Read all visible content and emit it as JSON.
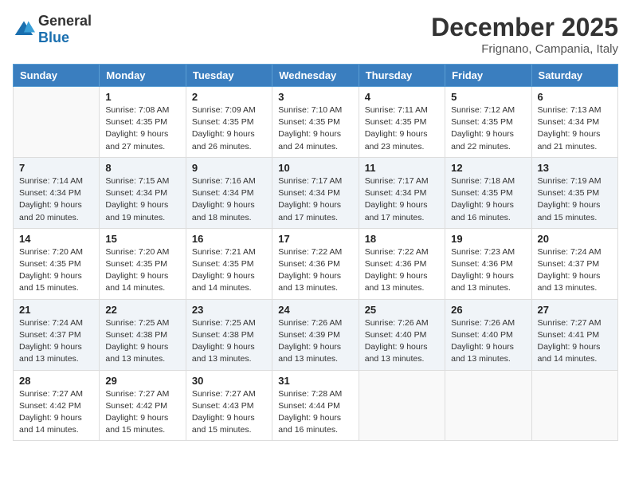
{
  "header": {
    "logo_general": "General",
    "logo_blue": "Blue",
    "month_title": "December 2025",
    "location": "Frignano, Campania, Italy"
  },
  "weekdays": [
    "Sunday",
    "Monday",
    "Tuesday",
    "Wednesday",
    "Thursday",
    "Friday",
    "Saturday"
  ],
  "weeks": [
    [
      {
        "day": "",
        "info": ""
      },
      {
        "day": "1",
        "info": "Sunrise: 7:08 AM\nSunset: 4:35 PM\nDaylight: 9 hours\nand 27 minutes."
      },
      {
        "day": "2",
        "info": "Sunrise: 7:09 AM\nSunset: 4:35 PM\nDaylight: 9 hours\nand 26 minutes."
      },
      {
        "day": "3",
        "info": "Sunrise: 7:10 AM\nSunset: 4:35 PM\nDaylight: 9 hours\nand 24 minutes."
      },
      {
        "day": "4",
        "info": "Sunrise: 7:11 AM\nSunset: 4:35 PM\nDaylight: 9 hours\nand 23 minutes."
      },
      {
        "day": "5",
        "info": "Sunrise: 7:12 AM\nSunset: 4:35 PM\nDaylight: 9 hours\nand 22 minutes."
      },
      {
        "day": "6",
        "info": "Sunrise: 7:13 AM\nSunset: 4:34 PM\nDaylight: 9 hours\nand 21 minutes."
      }
    ],
    [
      {
        "day": "7",
        "info": "Sunrise: 7:14 AM\nSunset: 4:34 PM\nDaylight: 9 hours\nand 20 minutes."
      },
      {
        "day": "8",
        "info": "Sunrise: 7:15 AM\nSunset: 4:34 PM\nDaylight: 9 hours\nand 19 minutes."
      },
      {
        "day": "9",
        "info": "Sunrise: 7:16 AM\nSunset: 4:34 PM\nDaylight: 9 hours\nand 18 minutes."
      },
      {
        "day": "10",
        "info": "Sunrise: 7:17 AM\nSunset: 4:34 PM\nDaylight: 9 hours\nand 17 minutes."
      },
      {
        "day": "11",
        "info": "Sunrise: 7:17 AM\nSunset: 4:34 PM\nDaylight: 9 hours\nand 17 minutes."
      },
      {
        "day": "12",
        "info": "Sunrise: 7:18 AM\nSunset: 4:35 PM\nDaylight: 9 hours\nand 16 minutes."
      },
      {
        "day": "13",
        "info": "Sunrise: 7:19 AM\nSunset: 4:35 PM\nDaylight: 9 hours\nand 15 minutes."
      }
    ],
    [
      {
        "day": "14",
        "info": "Sunrise: 7:20 AM\nSunset: 4:35 PM\nDaylight: 9 hours\nand 15 minutes."
      },
      {
        "day": "15",
        "info": "Sunrise: 7:20 AM\nSunset: 4:35 PM\nDaylight: 9 hours\nand 14 minutes."
      },
      {
        "day": "16",
        "info": "Sunrise: 7:21 AM\nSunset: 4:35 PM\nDaylight: 9 hours\nand 14 minutes."
      },
      {
        "day": "17",
        "info": "Sunrise: 7:22 AM\nSunset: 4:36 PM\nDaylight: 9 hours\nand 13 minutes."
      },
      {
        "day": "18",
        "info": "Sunrise: 7:22 AM\nSunset: 4:36 PM\nDaylight: 9 hours\nand 13 minutes."
      },
      {
        "day": "19",
        "info": "Sunrise: 7:23 AM\nSunset: 4:36 PM\nDaylight: 9 hours\nand 13 minutes."
      },
      {
        "day": "20",
        "info": "Sunrise: 7:24 AM\nSunset: 4:37 PM\nDaylight: 9 hours\nand 13 minutes."
      }
    ],
    [
      {
        "day": "21",
        "info": "Sunrise: 7:24 AM\nSunset: 4:37 PM\nDaylight: 9 hours\nand 13 minutes."
      },
      {
        "day": "22",
        "info": "Sunrise: 7:25 AM\nSunset: 4:38 PM\nDaylight: 9 hours\nand 13 minutes."
      },
      {
        "day": "23",
        "info": "Sunrise: 7:25 AM\nSunset: 4:38 PM\nDaylight: 9 hours\nand 13 minutes."
      },
      {
        "day": "24",
        "info": "Sunrise: 7:26 AM\nSunset: 4:39 PM\nDaylight: 9 hours\nand 13 minutes."
      },
      {
        "day": "25",
        "info": "Sunrise: 7:26 AM\nSunset: 4:40 PM\nDaylight: 9 hours\nand 13 minutes."
      },
      {
        "day": "26",
        "info": "Sunrise: 7:26 AM\nSunset: 4:40 PM\nDaylight: 9 hours\nand 13 minutes."
      },
      {
        "day": "27",
        "info": "Sunrise: 7:27 AM\nSunset: 4:41 PM\nDaylight: 9 hours\nand 14 minutes."
      }
    ],
    [
      {
        "day": "28",
        "info": "Sunrise: 7:27 AM\nSunset: 4:42 PM\nDaylight: 9 hours\nand 14 minutes."
      },
      {
        "day": "29",
        "info": "Sunrise: 7:27 AM\nSunset: 4:42 PM\nDaylight: 9 hours\nand 15 minutes."
      },
      {
        "day": "30",
        "info": "Sunrise: 7:27 AM\nSunset: 4:43 PM\nDaylight: 9 hours\nand 15 minutes."
      },
      {
        "day": "31",
        "info": "Sunrise: 7:28 AM\nSunset: 4:44 PM\nDaylight: 9 hours\nand 16 minutes."
      },
      {
        "day": "",
        "info": ""
      },
      {
        "day": "",
        "info": ""
      },
      {
        "day": "",
        "info": ""
      }
    ]
  ]
}
